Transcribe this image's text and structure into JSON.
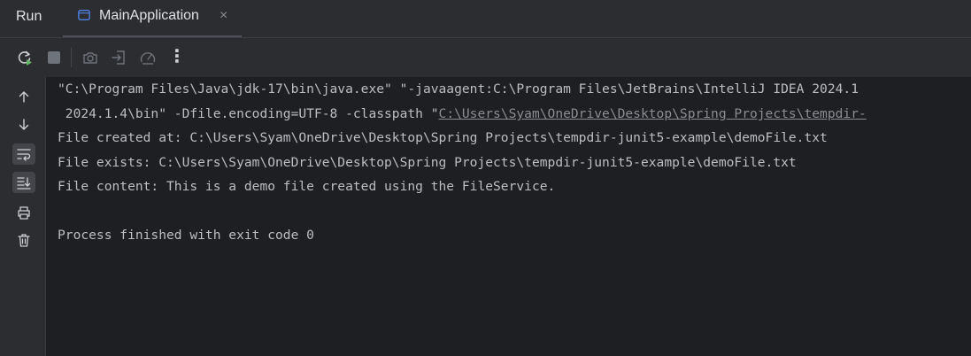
{
  "tool_window": {
    "title": "Run",
    "tab": {
      "label": "MainApplication",
      "close": "×"
    }
  },
  "toolbar": {
    "buttons": [
      "rerun-icon",
      "stop-icon",
      "camera-icon",
      "exit-icon",
      "dashboard-icon",
      "more-icon"
    ],
    "more_label": "⋮"
  },
  "sidebar": {
    "buttons": [
      "arrow-up-icon",
      "arrow-down-icon",
      "soft-wrap-icon",
      "scroll-to-end-icon",
      "print-icon",
      "trash-icon"
    ]
  },
  "console": {
    "line1": "\"C:\\Program Files\\Java\\jdk-17\\bin\\java.exe\" \"-javaagent:C:\\Program Files\\JetBrains\\IntelliJ IDEA 2024.1",
    "line2_prefix": " 2024.1.4\\bin\" -Dfile.encoding=UTF-8 -classpath \"",
    "line2_link": "C:\\Users\\Syam\\OneDrive\\Desktop\\Spring Projects\\tempdir-",
    "line3": "File created at: C:\\Users\\Syam\\OneDrive\\Desktop\\Spring Projects\\tempdir-junit5-example\\demoFile.txt",
    "line4": "File exists: C:\\Users\\Syam\\OneDrive\\Desktop\\Spring Projects\\tempdir-junit5-example\\demoFile.txt",
    "line5": "File content: This is a demo file created using the FileService.",
    "line6": "",
    "line7": "Process finished with exit code 0"
  },
  "colors": {
    "background": "#1e1f22",
    "panel": "#2b2d30",
    "text": "#bcbec4",
    "run_green": "#5fb865"
  }
}
